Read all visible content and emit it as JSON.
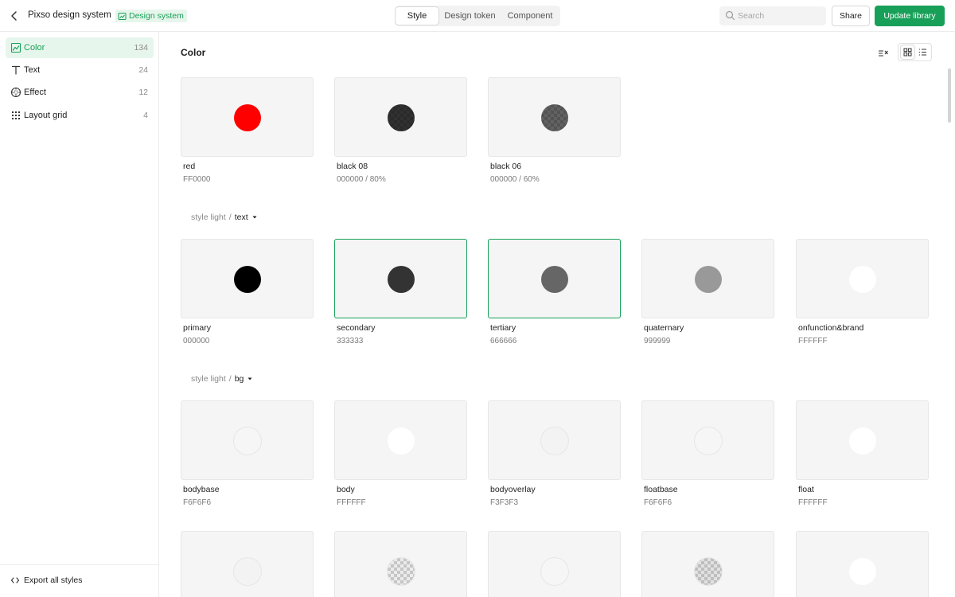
{
  "header": {
    "project_title": "Pixso design system",
    "badge": "Design system",
    "tabs": [
      "Style",
      "Design token",
      "Component"
    ],
    "active_tab": "Style",
    "search_placeholder": "Search",
    "share_label": "Share",
    "update_label": "Update library",
    "accent_color": "#18a058"
  },
  "sidebar": {
    "items": [
      {
        "label": "Color",
        "count": "134",
        "icon": "color-style-icon",
        "active": true
      },
      {
        "label": "Text",
        "count": "24",
        "icon": "text-style-icon",
        "active": false
      },
      {
        "label": "Effect",
        "count": "12",
        "icon": "effect-style-icon",
        "active": false
      },
      {
        "label": "Layout grid",
        "count": "4",
        "icon": "layout-grid-icon",
        "active": false
      }
    ],
    "export_label": "Export all styles"
  },
  "main": {
    "title": "Color",
    "view_mode": "grid",
    "top_colors": [
      {
        "name": "red",
        "value": "FF0000",
        "color": "#FF0000",
        "opacity": 1
      },
      {
        "name": "black 08",
        "value": "000000 / 80%",
        "color": "#000000",
        "opacity": 0.8
      },
      {
        "name": "black 06",
        "value": "000000 / 60%",
        "color": "#000000",
        "opacity": 0.6
      }
    ],
    "groups": [
      {
        "parent": "style light",
        "separator": "/",
        "name": "text",
        "items": [
          {
            "name": "primary",
            "value": "000000",
            "color": "#000000",
            "selected": false
          },
          {
            "name": "secondary",
            "value": "333333",
            "color": "#333333",
            "selected": true
          },
          {
            "name": "tertiary",
            "value": "666666",
            "color": "#666666",
            "selected": true
          },
          {
            "name": "quaternary",
            "value": "999999",
            "color": "#999999",
            "selected": false
          },
          {
            "name": "onfunction&brand",
            "value": "FFFFFF",
            "color": "#FFFFFF",
            "selected": false
          }
        ]
      },
      {
        "parent": "style light",
        "separator": "/",
        "name": "bg",
        "items": [
          {
            "name": "bodybase",
            "value": "F6F6F6",
            "color": "#F6F6F6",
            "selected": false
          },
          {
            "name": "body",
            "value": "FFFFFF",
            "color": "#FFFFFF",
            "selected": false
          },
          {
            "name": "bodyoverlay",
            "value": "F3F3F3",
            "color": "#F3F3F3",
            "selected": false
          },
          {
            "name": "floatbase",
            "value": "F6F6F6",
            "color": "#F6F6F6",
            "selected": false
          },
          {
            "name": "float",
            "value": "FFFFFF",
            "color": "#FFFFFF",
            "selected": false
          }
        ]
      }
    ],
    "partial_row": [
      {
        "color": "#F3F3F3",
        "checker": false
      },
      {
        "color": "#E8E8E8",
        "checker": true
      },
      {
        "color": "#F6F6F6",
        "checker": false
      },
      {
        "color": "#E0E0E0",
        "checker": true
      },
      {
        "color": "#FFFFFF",
        "checker": false
      }
    ]
  }
}
